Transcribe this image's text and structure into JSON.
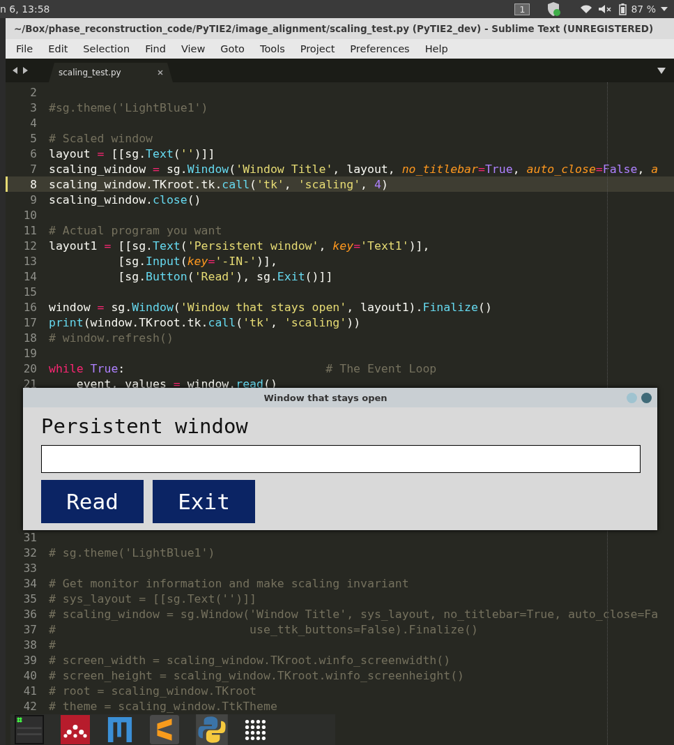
{
  "system_bar": {
    "clock": "n 6, 13:58",
    "workspace": "1",
    "battery": "87 %"
  },
  "window": {
    "title": "~/Box/phase_reconstruction_code/PyTIE2/image_alignment/scaling_test.py (PyTIE2_dev) - Sublime Text (UNREGISTERED)"
  },
  "menu": [
    "File",
    "Edit",
    "Selection",
    "Find",
    "View",
    "Goto",
    "Tools",
    "Project",
    "Preferences",
    "Help"
  ],
  "tabs": [
    {
      "label": "scaling_test.py",
      "selected": true
    }
  ],
  "editor": {
    "lines_top": [
      {
        "number": "2",
        "current": false
      },
      {
        "number": "3",
        "current": false,
        "tokens": [
          {
            "text": "#sg.theme('LightBlue1')",
            "kind": "comment"
          }
        ]
      },
      {
        "number": "4",
        "current": false
      },
      {
        "number": "5",
        "current": false,
        "tokens": [
          {
            "text": "# Scaled window",
            "kind": "comment"
          }
        ]
      },
      {
        "number": "6",
        "current": false,
        "tokens": [
          {
            "text": "layout ",
            "kind": "plain"
          },
          {
            "text": "=",
            "kind": "op"
          },
          {
            "text": " [[sg.",
            "kind": "plain"
          },
          {
            "text": "Text",
            "kind": "func"
          },
          {
            "text": "(",
            "kind": "plain"
          },
          {
            "text": "''",
            "kind": "string"
          },
          {
            "text": ")]]",
            "kind": "plain"
          }
        ]
      },
      {
        "number": "7",
        "current": false,
        "tokens": [
          {
            "text": "scaling_window ",
            "kind": "plain"
          },
          {
            "text": "=",
            "kind": "op"
          },
          {
            "text": " sg.",
            "kind": "plain"
          },
          {
            "text": "Window",
            "kind": "func"
          },
          {
            "text": "(",
            "kind": "plain"
          },
          {
            "text": "'Window Title'",
            "kind": "string"
          },
          {
            "text": ", layout, ",
            "kind": "plain"
          },
          {
            "text": "no_titlebar",
            "kind": "param"
          },
          {
            "text": "=",
            "kind": "op"
          },
          {
            "text": "True",
            "kind": "const"
          },
          {
            "text": ", ",
            "kind": "plain"
          },
          {
            "text": "auto_close",
            "kind": "param"
          },
          {
            "text": "=",
            "kind": "op"
          },
          {
            "text": "False",
            "kind": "const"
          },
          {
            "text": ", ",
            "kind": "plain"
          },
          {
            "text": "a",
            "kind": "param"
          }
        ]
      },
      {
        "number": "8",
        "current": true,
        "tokens": [
          {
            "text": "scaling_window.TKroot.tk.",
            "kind": "plain"
          },
          {
            "text": "call",
            "kind": "func"
          },
          {
            "text": "(",
            "kind": "plain"
          },
          {
            "text": "'tk'",
            "kind": "string"
          },
          {
            "text": ", ",
            "kind": "plain"
          },
          {
            "text": "'scaling'",
            "kind": "string"
          },
          {
            "text": ", ",
            "kind": "plain"
          },
          {
            "text": "4",
            "kind": "const"
          },
          {
            "text": ")",
            "kind": "plain"
          }
        ]
      },
      {
        "number": "9",
        "current": false,
        "tokens": [
          {
            "text": "scaling_window.",
            "kind": "plain"
          },
          {
            "text": "close",
            "kind": "func"
          },
          {
            "text": "()",
            "kind": "plain"
          }
        ]
      },
      {
        "number": "10",
        "current": false
      },
      {
        "number": "11",
        "current": false,
        "tokens": [
          {
            "text": "# Actual program you want",
            "kind": "comment"
          }
        ]
      },
      {
        "number": "12",
        "current": false,
        "tokens": [
          {
            "text": "layout1 ",
            "kind": "plain"
          },
          {
            "text": "=",
            "kind": "op"
          },
          {
            "text": " [[sg.",
            "kind": "plain"
          },
          {
            "text": "Text",
            "kind": "func"
          },
          {
            "text": "(",
            "kind": "plain"
          },
          {
            "text": "'Persistent window'",
            "kind": "string"
          },
          {
            "text": ", ",
            "kind": "plain"
          },
          {
            "text": "key",
            "kind": "param"
          },
          {
            "text": "=",
            "kind": "op"
          },
          {
            "text": "'Text1'",
            "kind": "string"
          },
          {
            "text": ")],",
            "kind": "plain"
          }
        ]
      },
      {
        "number": "13",
        "current": false,
        "tokens": [
          {
            "text": "          [sg.",
            "kind": "plain"
          },
          {
            "text": "Input",
            "kind": "func"
          },
          {
            "text": "(",
            "kind": "plain"
          },
          {
            "text": "key",
            "kind": "param"
          },
          {
            "text": "=",
            "kind": "op"
          },
          {
            "text": "'-IN-'",
            "kind": "string"
          },
          {
            "text": ")],",
            "kind": "plain"
          }
        ]
      },
      {
        "number": "14",
        "current": false,
        "tokens": [
          {
            "text": "          [sg.",
            "kind": "plain"
          },
          {
            "text": "Button",
            "kind": "func"
          },
          {
            "text": "(",
            "kind": "plain"
          },
          {
            "text": "'Read'",
            "kind": "string"
          },
          {
            "text": "), sg.",
            "kind": "plain"
          },
          {
            "text": "Exit",
            "kind": "func"
          },
          {
            "text": "()]]",
            "kind": "plain"
          }
        ]
      },
      {
        "number": "15",
        "current": false
      },
      {
        "number": "16",
        "current": false,
        "tokens": [
          {
            "text": "window ",
            "kind": "plain"
          },
          {
            "text": "=",
            "kind": "op"
          },
          {
            "text": " sg.",
            "kind": "plain"
          },
          {
            "text": "Window",
            "kind": "func"
          },
          {
            "text": "(",
            "kind": "plain"
          },
          {
            "text": "'Window that stays open'",
            "kind": "string"
          },
          {
            "text": ", layout1).",
            "kind": "plain"
          },
          {
            "text": "Finalize",
            "kind": "func"
          },
          {
            "text": "()",
            "kind": "plain"
          }
        ]
      },
      {
        "number": "17",
        "current": false,
        "tokens": [
          {
            "text": "print",
            "kind": "func"
          },
          {
            "text": "(window.TKroot.tk.",
            "kind": "plain"
          },
          {
            "text": "call",
            "kind": "func"
          },
          {
            "text": "(",
            "kind": "plain"
          },
          {
            "text": "'tk'",
            "kind": "string"
          },
          {
            "text": ", ",
            "kind": "plain"
          },
          {
            "text": "'scaling'",
            "kind": "string"
          },
          {
            "text": "))",
            "kind": "plain"
          }
        ]
      },
      {
        "number": "18",
        "current": false,
        "tokens": [
          {
            "text": "# window.refresh()",
            "kind": "comment"
          }
        ]
      },
      {
        "number": "19",
        "current": false
      },
      {
        "number": "20",
        "current": false,
        "tokens": [
          {
            "text": "while",
            "kind": "op"
          },
          {
            "text": " True",
            "kind": "const"
          },
          {
            "text": ":",
            "kind": "plain"
          },
          {
            "text": "                             # The Event Loop",
            "kind": "comment"
          }
        ]
      },
      {
        "number": "21",
        "current": false,
        "tokens": [
          {
            "text": "    event, values ",
            "kind": "plain"
          },
          {
            "text": "=",
            "kind": "op"
          },
          {
            "text": " window.",
            "kind": "plain"
          },
          {
            "text": "read",
            "kind": "func"
          },
          {
            "text": "()",
            "kind": "plain"
          }
        ]
      }
    ],
    "lines_bottom": [
      {
        "number": "31",
        "current": false
      },
      {
        "number": "32",
        "current": false,
        "tokens": [
          {
            "text": "# sg.theme('LightBlue1')",
            "kind": "comment"
          }
        ]
      },
      {
        "number": "33",
        "current": false
      },
      {
        "number": "34",
        "current": false,
        "tokens": [
          {
            "text": "# Get monitor information and make scaling invariant",
            "kind": "comment"
          }
        ]
      },
      {
        "number": "35",
        "current": false,
        "tokens": [
          {
            "text": "# sys_layout = [[sg.Text('')]]",
            "kind": "comment"
          }
        ]
      },
      {
        "number": "36",
        "current": false,
        "tokens": [
          {
            "text": "# scaling_window = sg.Window('Window Title', sys_layout, no_titlebar=True, auto_close=Fa",
            "kind": "comment"
          }
        ]
      },
      {
        "number": "37",
        "current": false,
        "tokens": [
          {
            "text": "#                            use_ttk_buttons=False).Finalize()",
            "kind": "comment"
          }
        ]
      },
      {
        "number": "38",
        "current": false,
        "tokens": [
          {
            "text": "#",
            "kind": "comment"
          }
        ]
      },
      {
        "number": "39",
        "current": false,
        "tokens": [
          {
            "text": "# screen_width = scaling_window.TKroot.winfo_screenwidth()",
            "kind": "comment"
          }
        ]
      },
      {
        "number": "40",
        "current": false,
        "tokens": [
          {
            "text": "# screen_height = scaling_window.TKroot.winfo_screenheight()",
            "kind": "comment"
          }
        ]
      },
      {
        "number": "41",
        "current": false,
        "tokens": [
          {
            "text": "# root = scaling_window.TKroot",
            "kind": "comment"
          }
        ]
      },
      {
        "number": "42",
        "current": false,
        "tokens": [
          {
            "text": "# theme = scaling_window.TtkTheme",
            "kind": "comment"
          }
        ]
      }
    ]
  },
  "dialog": {
    "title": "Window that stays open",
    "text": "Persistent window",
    "buttons": [
      "Read",
      "Exit"
    ]
  }
}
